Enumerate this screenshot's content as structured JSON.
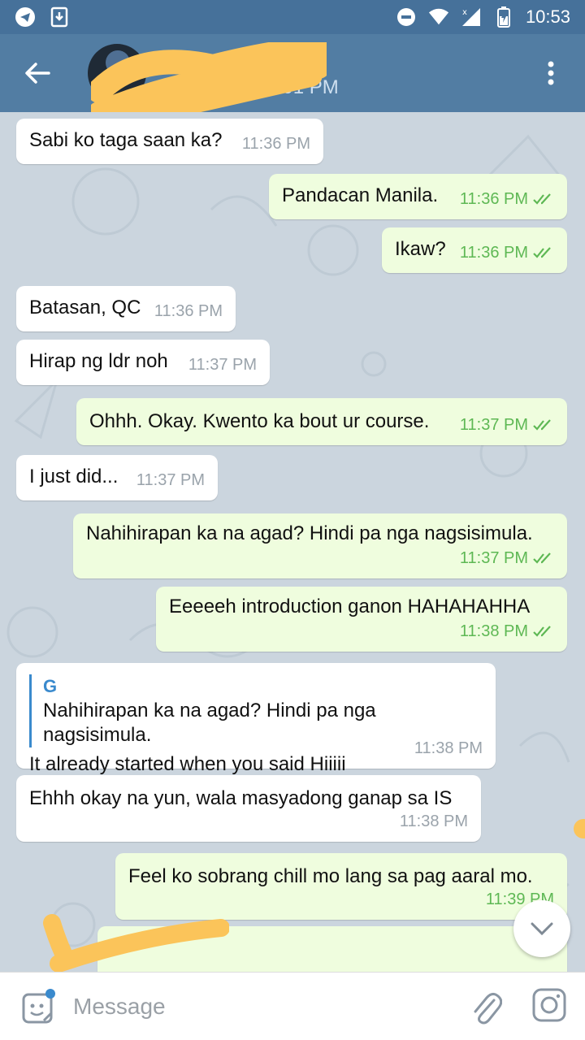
{
  "status_bar": {
    "time": "10:53",
    "icons": [
      "telegram-icon",
      "download-icon",
      "do-not-disturb-icon",
      "wifi-icon",
      "signal-icon",
      "battery-charging-icon"
    ]
  },
  "header": {
    "contact_name": "",
    "last_seen": "last seen at 9:01 PM",
    "back_icon": "arrow-left-icon",
    "menu_icon": "more-vertical-icon"
  },
  "colors": {
    "status_bar": "#46719a",
    "header": "#527da3",
    "incoming_bubble": "#ffffff",
    "outgoing_bubble": "#effdde",
    "read_check": "#5eb854",
    "quote_accent": "#3a8acd",
    "redaction": "#fbc45a"
  },
  "messages": [
    {
      "dir": "in",
      "text": "Sabi ko taga saan ka?",
      "time": "11:36 PM"
    },
    {
      "dir": "out",
      "text": "Pandacan Manila.",
      "time": "11:36 PM"
    },
    {
      "dir": "out",
      "text": "Ikaw?",
      "time": "11:36 PM"
    },
    {
      "dir": "in",
      "text": "Batasan, QC",
      "time": "11:36 PM"
    },
    {
      "dir": "in",
      "text": "Hirap ng ldr noh",
      "time": "11:37 PM"
    },
    {
      "dir": "out",
      "text": "Ohhh. Okay. Kwento ka bout ur course.",
      "time": "11:37 PM"
    },
    {
      "dir": "in",
      "text": "I just did...",
      "time": "11:37 PM"
    },
    {
      "dir": "out",
      "text": "Nahihirapan ka na agad? Hindi pa nga nagsisimula.",
      "time": "11:37 PM"
    },
    {
      "dir": "out",
      "text": "Eeeeeh introduction ganon HAHAHAHHA",
      "time": "11:38 PM"
    },
    {
      "dir": "in",
      "quote_name": "G",
      "quote_text": "Nahihirapan ka na agad? Hindi pa nga nagsisimula.",
      "text": "It already started when you said Hiiiii",
      "time": "11:38 PM"
    },
    {
      "dir": "in",
      "text": "Ehhh okay na yun, wala masyadong ganap sa IS",
      "time": "11:38 PM"
    },
    {
      "dir": "out",
      "text": "Feel ko sobrang chill mo lang sa pag aaral mo.",
      "time": "11:39 PM"
    },
    {
      "dir": "out",
      "quote_name": "",
      "quote_text": "",
      "text": "",
      "time": ""
    }
  ],
  "input": {
    "placeholder": "Message",
    "sticker_icon": "sticker-icon",
    "attach_icon": "paperclip-icon",
    "camera_icon": "camera-icon"
  }
}
